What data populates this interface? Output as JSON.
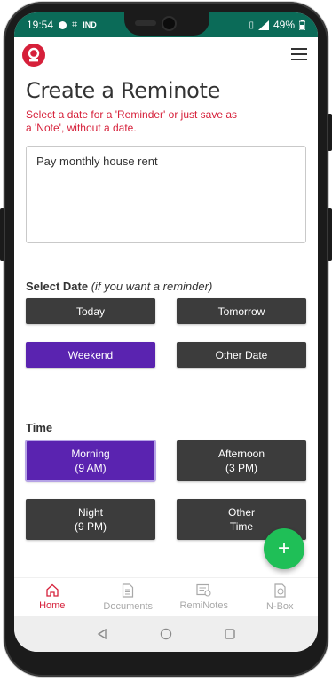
{
  "status_bar": {
    "time": "19:54",
    "carrier": "IND",
    "battery": "49%"
  },
  "page": {
    "title": "Create a Reminote",
    "hint": "Select a date for a 'Reminder' or just save as a 'Note', without a date.",
    "note_text": "Pay monthly house rent"
  },
  "date_section": {
    "label": "Select Date",
    "sublabel": "(if you want a reminder)",
    "options": [
      "Today",
      "Tomorrow",
      "Weekend",
      "Other Date"
    ],
    "selected": "Weekend"
  },
  "time_section": {
    "label": "Time",
    "options": [
      {
        "line1": "Morning",
        "line2": "(9 AM)"
      },
      {
        "line1": "Afternoon",
        "line2": "(3 PM)"
      },
      {
        "line1": "Night",
        "line2": "(9 PM)"
      },
      {
        "line1": "Other",
        "line2": "Time"
      }
    ],
    "selected": "Morning"
  },
  "fab": {
    "label": "+"
  },
  "bottom_nav": {
    "items": [
      {
        "label": "Home",
        "icon": "home-icon"
      },
      {
        "label": "Documents",
        "icon": "document-icon"
      },
      {
        "label": "RemiNotes",
        "icon": "reminotes-icon"
      },
      {
        "label": "N-Box",
        "icon": "nbox-icon"
      }
    ],
    "active": "Home"
  },
  "colors": {
    "status_bar": "#0b6b58",
    "accent": "#d6203a",
    "selected": "#5a23b0",
    "button": "#3c3c3c",
    "fab": "#1fbf57"
  }
}
